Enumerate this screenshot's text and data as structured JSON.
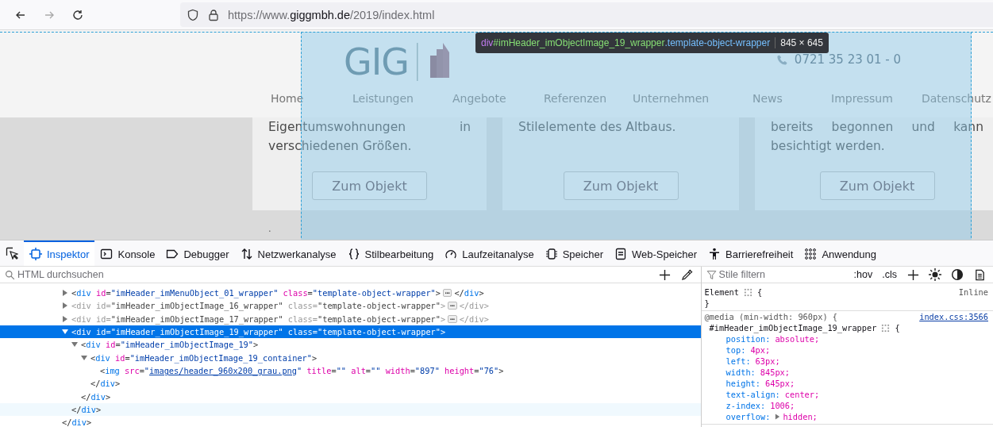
{
  "browser": {
    "buttons": [
      {
        "kind": "back",
        "disabled": false
      },
      {
        "kind": "forward",
        "disabled": true
      },
      {
        "kind": "reload",
        "disabled": false
      }
    ],
    "url": "https://www.**giggmbh.de**/2019/index.html"
  },
  "page": {
    "logo_text": "GIG",
    "phone": "0721 35 23 01 - 0",
    "nav": [
      "Home",
      "Leistungen",
      "Angebote",
      "Referenzen",
      "Unternehmen",
      "News",
      "Impressum",
      "Datenschutz"
    ],
    "cards": [
      {
        "text": "Eigentumswohnungen in verschiedenen Größen.",
        "button": "Zum Objekt"
      },
      {
        "text": "Stilelemente des Altbaus.",
        "button": "Zum Objekt"
      },
      {
        "text": "bereits begonnen und kann besichtigt werden.",
        "button": "Zum Objekt"
      }
    ],
    "footer_mark": "."
  },
  "highlighter": {
    "tag": "div",
    "id": "#imHeader_imObjectImage_19_wrapper",
    "class": ".template-object-wrapper",
    "size": "845 × 645"
  },
  "devtools": {
    "tabs": [
      {
        "label": "Inspektor",
        "selected": true
      },
      {
        "label": "Konsole",
        "selected": false
      },
      {
        "label": "Debugger",
        "selected": false
      },
      {
        "label": "Netzwerkanalyse",
        "selected": false
      },
      {
        "label": "Stilbearbeitung",
        "selected": false
      },
      {
        "label": "Laufzeitanalyse",
        "selected": false
      },
      {
        "label": "Speicher",
        "selected": false
      },
      {
        "label": "Web-Speicher",
        "selected": false
      },
      {
        "label": "Barrierefreiheit",
        "selected": false
      },
      {
        "label": "Anwendung",
        "selected": false
      }
    ],
    "search_placeholder": "HTML durchsuchen"
  },
  "html_tree": {
    "nodes": [
      {
        "kind": "collapsed",
        "selected": false,
        "hovered": false,
        "dimmed": false,
        "text": [
          {
            "kind": "p",
            "t": "<"
          },
          {
            "kind": "tag",
            "t": "div"
          },
          {
            "kind": "attr",
            "t": " id"
          },
          {
            "kind": "p",
            "t": "="
          },
          {
            "kind": "val",
            "t": "\"imHeader_imMenuObject_01_wrapper\""
          },
          {
            "kind": "attr",
            "t": " class"
          },
          {
            "kind": "p",
            "t": "="
          },
          {
            "kind": "val",
            "t": "\"template-object-wrapper\""
          },
          {
            "kind": "p",
            "t": ">"
          }
        ],
        "badge": "⋯",
        "after": [
          {
            "kind": "p",
            "t": "</"
          },
          {
            "kind": "tag",
            "t": "div"
          },
          {
            "kind": "p",
            "t": ">"
          }
        ]
      },
      {
        "kind": "collapsed",
        "selected": false,
        "hovered": false,
        "dimmed": true,
        "text": [
          {
            "kind": "p",
            "t": "<"
          },
          {
            "kind": "tag",
            "t": "div"
          },
          {
            "kind": "attr",
            "t": " id"
          },
          {
            "kind": "p",
            "t": "="
          },
          {
            "kind": "val",
            "t": "\"imHeader_imObjectImage_16_wrapper\""
          },
          {
            "kind": "attr",
            "t": " class"
          },
          {
            "kind": "p",
            "t": "="
          },
          {
            "kind": "val",
            "t": "\"template-object-wrapper\""
          },
          {
            "kind": "p",
            "t": ">"
          }
        ],
        "badge": "⋯",
        "after": [
          {
            "kind": "p",
            "t": "</"
          },
          {
            "kind": "tag",
            "t": "div"
          },
          {
            "kind": "p",
            "t": ">"
          }
        ]
      },
      {
        "kind": "collapsed",
        "selected": false,
        "hovered": false,
        "dimmed": true,
        "text": [
          {
            "kind": "p",
            "t": "<"
          },
          {
            "kind": "tag",
            "t": "div"
          },
          {
            "kind": "attr",
            "t": " id"
          },
          {
            "kind": "p",
            "t": "="
          },
          {
            "kind": "val",
            "t": "\"imHeader_imObjectImage_17_wrapper\""
          },
          {
            "kind": "attr",
            "t": " class"
          },
          {
            "kind": "p",
            "t": "="
          },
          {
            "kind": "val",
            "t": "\"template-object-wrapper\""
          },
          {
            "kind": "p",
            "t": ">"
          }
        ],
        "badge": "⋯",
        "after": [
          {
            "kind": "p",
            "t": "</"
          },
          {
            "kind": "tag",
            "t": "div"
          },
          {
            "kind": "p",
            "t": ">"
          }
        ]
      },
      {
        "kind": "expanded",
        "selected": true,
        "hovered": false,
        "dimmed": false,
        "text": [
          {
            "kind": "p",
            "t": "<"
          },
          {
            "kind": "tag",
            "t": "div"
          },
          {
            "kind": "attr",
            "t": " id"
          },
          {
            "kind": "p",
            "t": "="
          },
          {
            "kind": "val",
            "t": "\"imHeader_imObjectImage_19_wrapper\""
          },
          {
            "kind": "attr",
            "t": " class"
          },
          {
            "kind": "p",
            "t": "="
          },
          {
            "kind": "val",
            "t": "\"template-object-wrapper\""
          },
          {
            "kind": "p",
            "t": ">"
          }
        ],
        "children": [
          {
            "kind": "expanded",
            "selected": false,
            "hovered": false,
            "dimmed": false,
            "text": [
              {
                "kind": "p",
                "t": "<"
              },
              {
                "kind": "tag",
                "t": "div"
              },
              {
                "kind": "attr",
                "t": " id"
              },
              {
                "kind": "p",
                "t": "="
              },
              {
                "kind": "val",
                "t": "\"imHeader_imObjectImage_19\""
              },
              {
                "kind": "p",
                "t": ">"
              }
            ],
            "children": [
              {
                "kind": "expanded",
                "selected": false,
                "hovered": false,
                "dimmed": false,
                "text": [
                  {
                    "kind": "p",
                    "t": "<"
                  },
                  {
                    "kind": "tag",
                    "t": "div"
                  },
                  {
                    "kind": "attr",
                    "t": " id"
                  },
                  {
                    "kind": "p",
                    "t": "="
                  },
                  {
                    "kind": "val",
                    "t": "\"imHeader_imObjectImage_19_container\""
                  },
                  {
                    "kind": "p",
                    "t": ">"
                  }
                ],
                "children": [
                  {
                    "kind": "leaf",
                    "selected": false,
                    "hovered": false,
                    "dimmed": false,
                    "text": [
                      {
                        "kind": "p",
                        "t": "<"
                      },
                      {
                        "kind": "tag",
                        "t": "img"
                      },
                      {
                        "kind": "attr",
                        "t": " src"
                      },
                      {
                        "kind": "p",
                        "t": "="
                      },
                      {
                        "kind": "val",
                        "t": "\""
                      },
                      {
                        "kind": "link",
                        "t": "images/header_960x200_grau.png"
                      },
                      {
                        "kind": "val",
                        "t": "\""
                      },
                      {
                        "kind": "attr",
                        "t": " title"
                      },
                      {
                        "kind": "p",
                        "t": "="
                      },
                      {
                        "kind": "val",
                        "t": "\"\""
                      },
                      {
                        "kind": "attr",
                        "t": " alt"
                      },
                      {
                        "kind": "p",
                        "t": "="
                      },
                      {
                        "kind": "val",
                        "t": "\"\""
                      },
                      {
                        "kind": "attr",
                        "t": " width"
                      },
                      {
                        "kind": "p",
                        "t": "="
                      },
                      {
                        "kind": "val",
                        "t": "\"897\""
                      },
                      {
                        "kind": "attr",
                        "t": " height"
                      },
                      {
                        "kind": "p",
                        "t": "="
                      },
                      {
                        "kind": "val",
                        "t": "\"76\""
                      },
                      {
                        "kind": "p",
                        "t": ">"
                      }
                    ]
                  }
                ]
              },
              {
                "kind": "leaf",
                "selected": false,
                "hovered": false,
                "dimmed": false,
                "text": [
                  {
                    "kind": "p",
                    "t": "</"
                  },
                  {
                    "kind": "tag",
                    "t": "div"
                  },
                  {
                    "kind": "p",
                    "t": ">"
                  }
                ]
              }
            ]
          },
          {
            "kind": "leaf",
            "selected": false,
            "hovered": false,
            "dimmed": false,
            "text": [
              {
                "kind": "p",
                "t": "</"
              },
              {
                "kind": "tag",
                "t": "div"
              },
              {
                "kind": "p",
                "t": ">"
              }
            ]
          }
        ]
      },
      {
        "kind": "leaf",
        "selected": false,
        "hovered": true,
        "dimmed": false,
        "text": [
          {
            "kind": "p",
            "t": "</"
          },
          {
            "kind": "tag",
            "t": "div"
          },
          {
            "kind": "p",
            "t": ">"
          }
        ]
      }
    ],
    "after": [
      {
        "kind": "leaf",
        "selected": false,
        "hovered": false,
        "dimmed": false,
        "text": [
          {
            "kind": "p",
            "t": "</"
          },
          {
            "kind": "tag",
            "t": "div"
          },
          {
            "kind": "p",
            "t": ">"
          }
        ]
      }
    ]
  },
  "styles": {
    "filter_placeholder": "Stile filtern",
    "buttons": [
      ":hov",
      ".cls"
    ],
    "rules": [
      {
        "kind": "element",
        "selector": "Element",
        "brace": "{",
        "source": "Inline",
        "close": "}"
      },
      {
        "kind": "media",
        "media": "@media (min-width: 960px) {",
        "source": "index.css:3566",
        "selector": "#imHeader_imObjectImage_19_wrapper",
        "brace": "{",
        "declarations": [
          {
            "name": "position:",
            "value": "absolute;",
            "expandable": false
          },
          {
            "name": "top:",
            "value": "4px;",
            "expandable": false
          },
          {
            "name": "left:",
            "value": "63px;",
            "expandable": false
          },
          {
            "name": "width:",
            "value": "845px;",
            "expandable": false
          },
          {
            "name": "height:",
            "value": "645px;",
            "expandable": false
          },
          {
            "name": "text-align:",
            "value": "center;",
            "expandable": false
          },
          {
            "name": "z-index:",
            "value": "1006;",
            "expandable": false
          },
          {
            "name": "overflow:",
            "value": "hidden;",
            "expandable": true
          }
        ]
      }
    ]
  }
}
